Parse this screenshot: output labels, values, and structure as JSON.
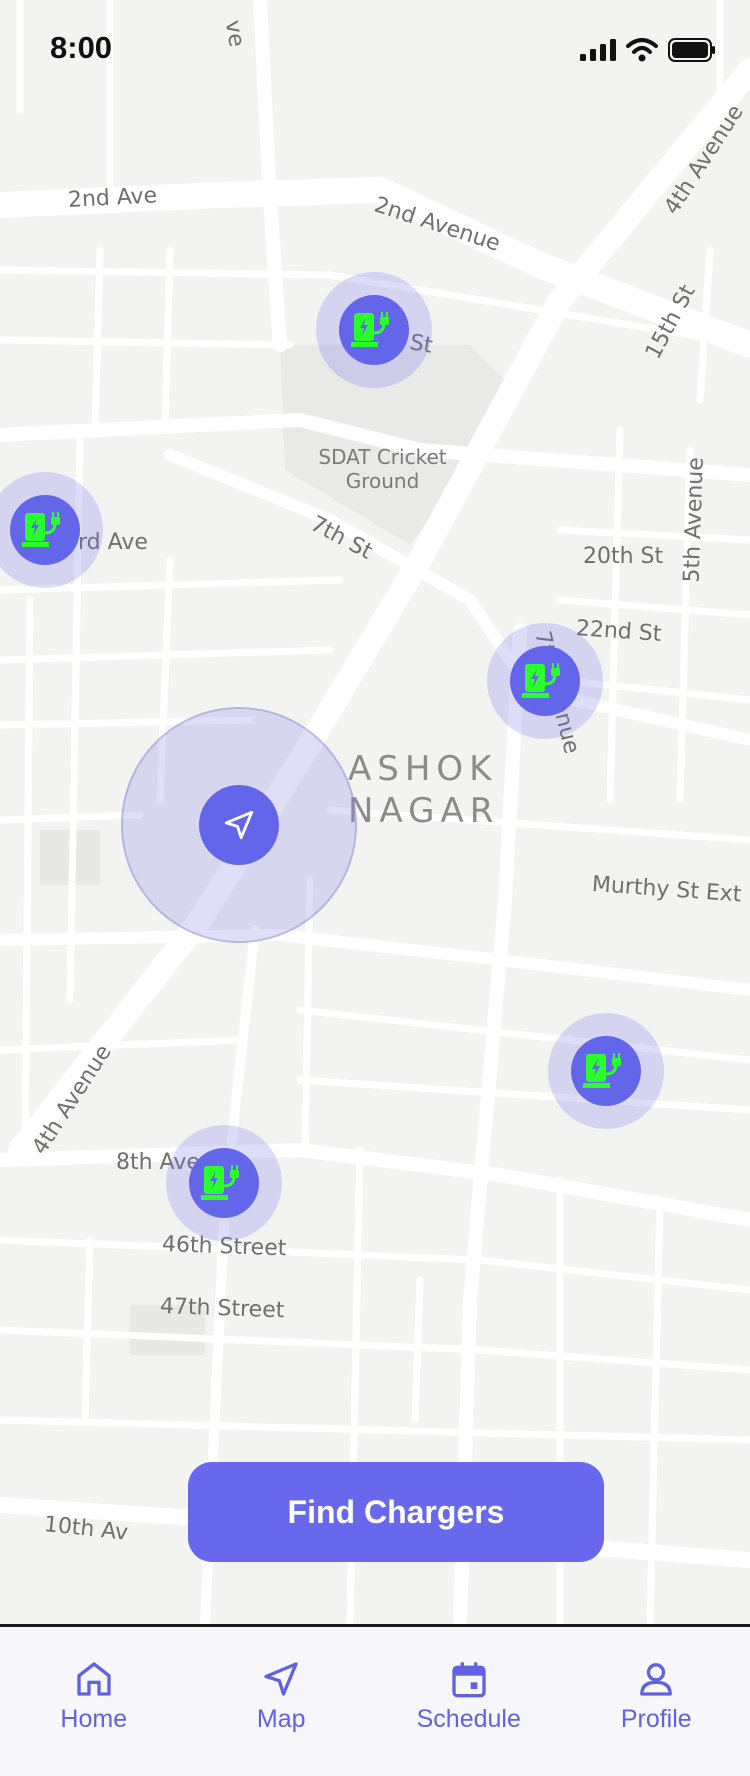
{
  "status_bar": {
    "time": "8:00"
  },
  "map": {
    "streets": [
      "2nd Ave",
      "2nd Avenue",
      "4th Avenue",
      "15th St",
      "St",
      "rd Ave",
      "7th St",
      "20th St",
      "22nd St",
      "5th Avenue",
      "7th Avenue",
      "Murthy St Ext",
      "4th Avenue",
      "8th Ave",
      "46th Street",
      "47th Street",
      "10th Av",
      "ve"
    ],
    "area": {
      "line1": "ASHOK",
      "line2": "NAGAR"
    },
    "poi": {
      "line1": "SDAT Cricket",
      "line2": "Ground"
    }
  },
  "actions": {
    "find_chargers": "Find Chargers"
  },
  "nav": [
    {
      "label": "Home",
      "icon": "home-icon"
    },
    {
      "label": "Map",
      "icon": "navigation-icon"
    },
    {
      "label": "Schedule",
      "icon": "calendar-icon"
    },
    {
      "label": "Profile",
      "icon": "user-icon"
    }
  ],
  "colors": {
    "accent": "#6466e9",
    "charger_icon": "#2bff2b",
    "map_bg": "#f3f3f2",
    "road": "#ffffff"
  }
}
